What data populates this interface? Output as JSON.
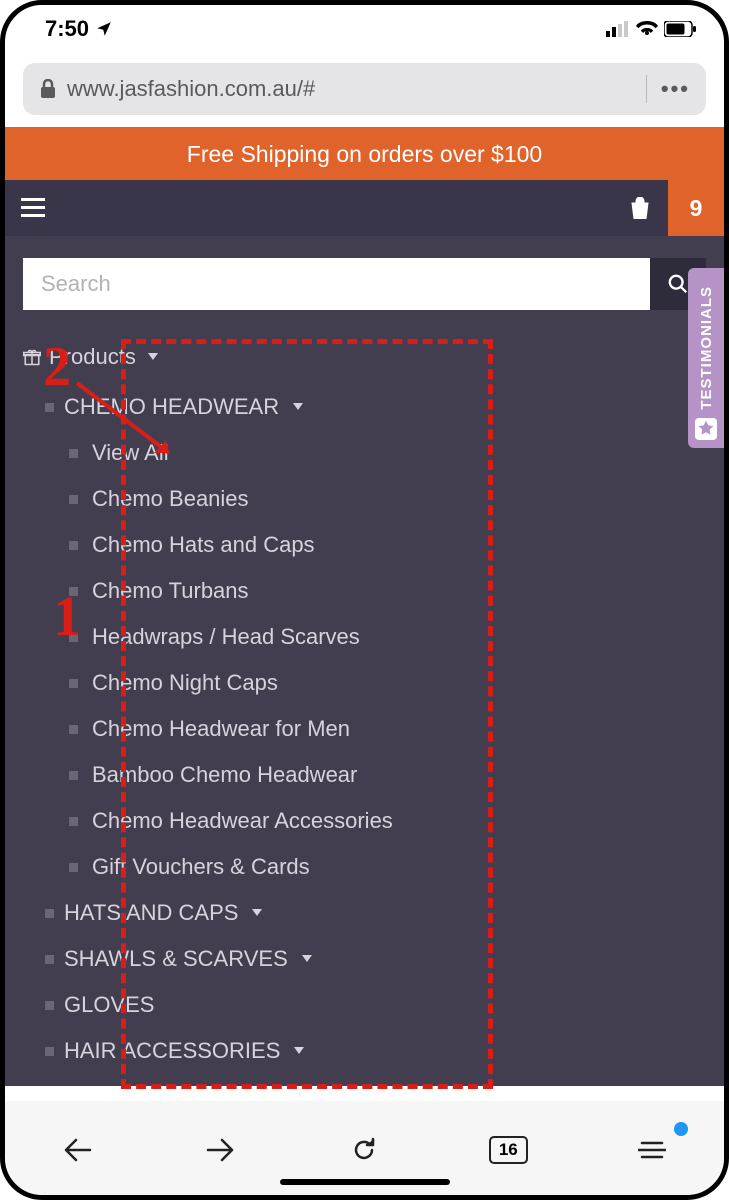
{
  "status": {
    "time": "7:50"
  },
  "url": "www.jasfashion.com.au/#",
  "banner_text": "Free Shipping on orders over $100",
  "cart_count": "9",
  "search_placeholder": "Search",
  "testimonials_label": "TESTIMONIALS",
  "menu": {
    "root": "Products",
    "categories": [
      {
        "label": "CHEMO HEADWEAR",
        "expandable": true
      },
      {
        "label": "HATS AND CAPS",
        "expandable": true
      },
      {
        "label": "SHAWLS & SCARVES",
        "expandable": true
      },
      {
        "label": "GLOVES",
        "expandable": false
      },
      {
        "label": "HAIR ACCESSORIES",
        "expandable": true
      }
    ],
    "chemo_children": [
      "View All",
      "Chemo Beanies",
      "Chemo Hats and Caps",
      "Chemo Turbans",
      "Headwraps / Head Scarves",
      "Chemo Night Caps",
      "Chemo Headwear for Men",
      "Bamboo Chemo Headwear",
      "Chemo Headwear Accessories",
      "Gift Vouchers & Cards"
    ]
  },
  "tabs_count": "16",
  "annotations": {
    "label1": "1",
    "label2": "2"
  }
}
